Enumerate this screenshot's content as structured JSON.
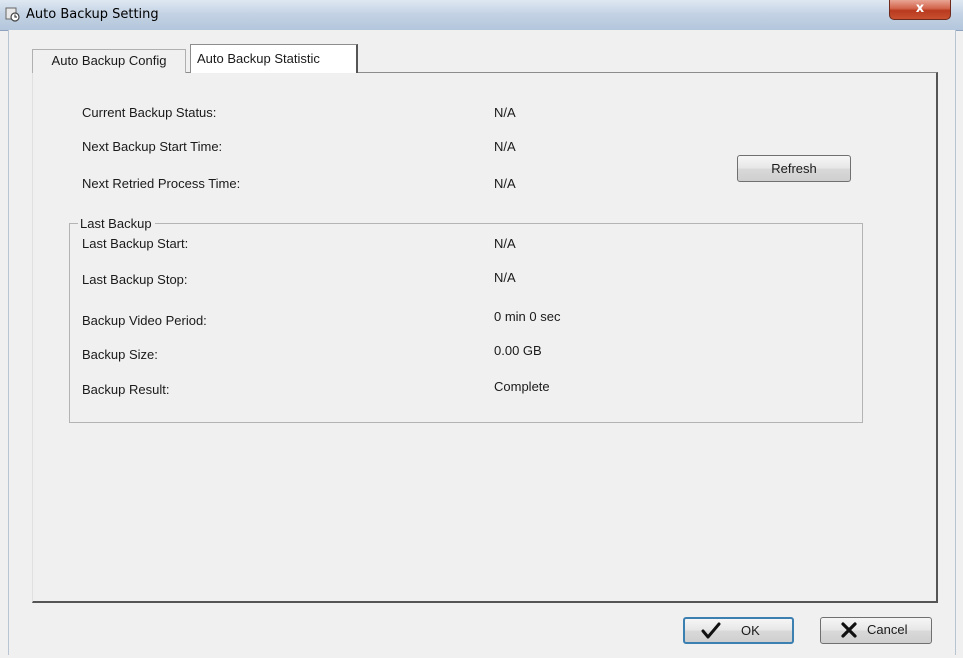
{
  "window": {
    "title": "Auto Backup Setting",
    "close_label": "x"
  },
  "tabs": [
    {
      "label": "Auto Backup Config"
    },
    {
      "label": "Auto Backup Statistic"
    }
  ],
  "status": {
    "current_backup_status": {
      "label": "Current Backup Status:",
      "value": "N/A"
    },
    "next_backup_start_time": {
      "label": "Next Backup Start Time:",
      "value": "N/A"
    },
    "next_retried_process_time": {
      "label": "Next Retried Process Time:",
      "value": "N/A"
    }
  },
  "refresh_label": "Refresh",
  "last_backup": {
    "title": "Last Backup",
    "start": {
      "label": "Last Backup Start:",
      "value": "N/A"
    },
    "stop": {
      "label": "Last Backup Stop:",
      "value": "N/A"
    },
    "video_period": {
      "label": "Backup Video Period:",
      "value": "0 min 0 sec"
    },
    "size": {
      "label": "Backup Size:",
      "value": "0.00 GB"
    },
    "result": {
      "label": "Backup Result:",
      "value": "Complete"
    }
  },
  "footer": {
    "ok_label": "OK",
    "cancel_label": "Cancel"
  }
}
